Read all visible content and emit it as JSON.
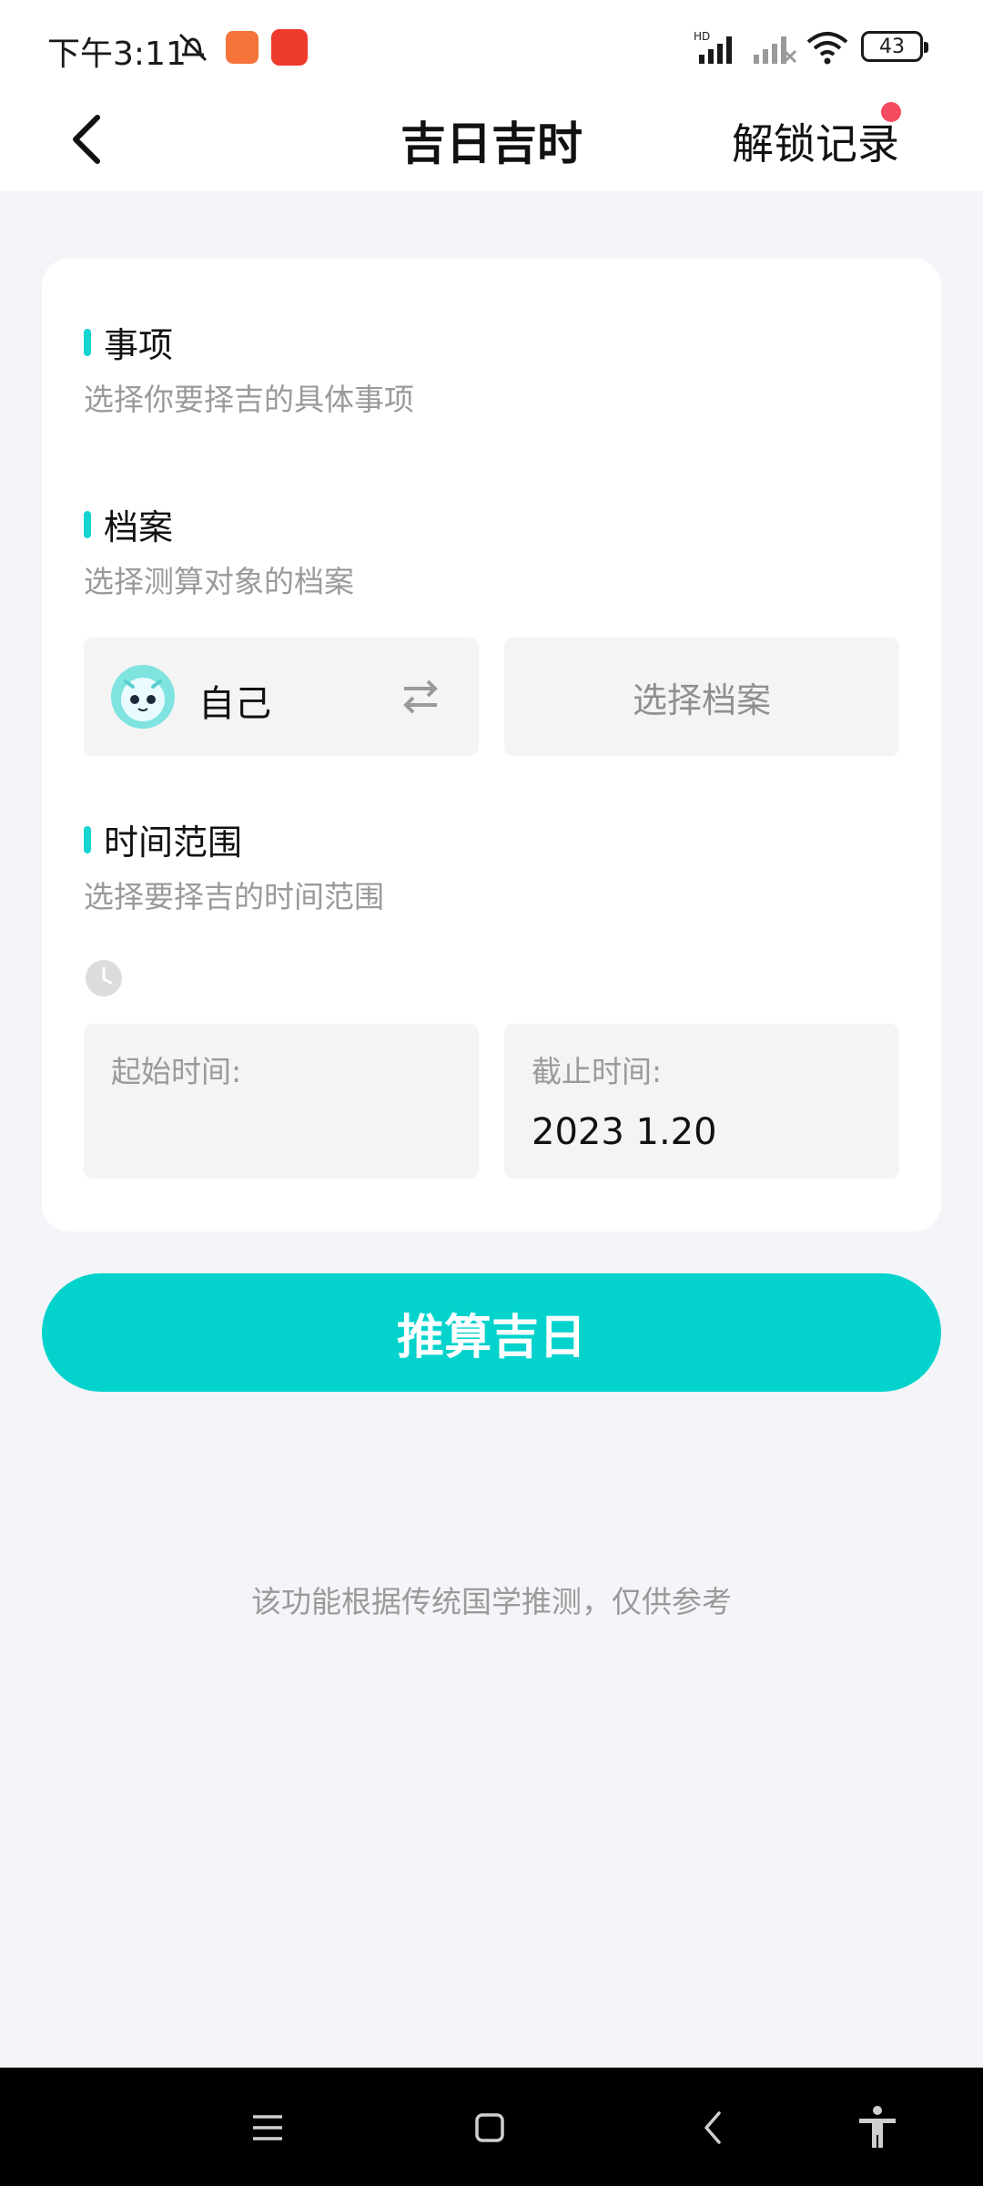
{
  "status_bar": {
    "time": "下午3:11",
    "battery": "43",
    "icons": [
      "mute-icon",
      "app-notification-icon",
      "app-notification-icon",
      "hd-signal-icon",
      "no-signal-icon",
      "wifi-icon",
      "battery-icon"
    ]
  },
  "header": {
    "title": "吉日吉时",
    "right_link": "解锁记录",
    "has_red_dot": true
  },
  "form": {
    "matter": {
      "title": "事项",
      "subtitle": "选择你要择吉的具体事项"
    },
    "profile": {
      "title": "档案",
      "subtitle": "选择测算对象的档案",
      "selected_name": "自己",
      "choose_label": "选择档案"
    },
    "time_range": {
      "title": "时间范围",
      "subtitle": "选择要择吉的时间范围",
      "start_label": "起始时间:",
      "start_value": "",
      "end_label": "截止时间:",
      "end_value": "2023 1.20"
    }
  },
  "cta": {
    "label": "推算吉日"
  },
  "disclaimer": "该功能根据传统国学推测，仅供参考",
  "colors": {
    "accent": "#14d4d0",
    "button": "#04d3cd",
    "background": "#f3f5f8",
    "dot": "#f64b61"
  }
}
